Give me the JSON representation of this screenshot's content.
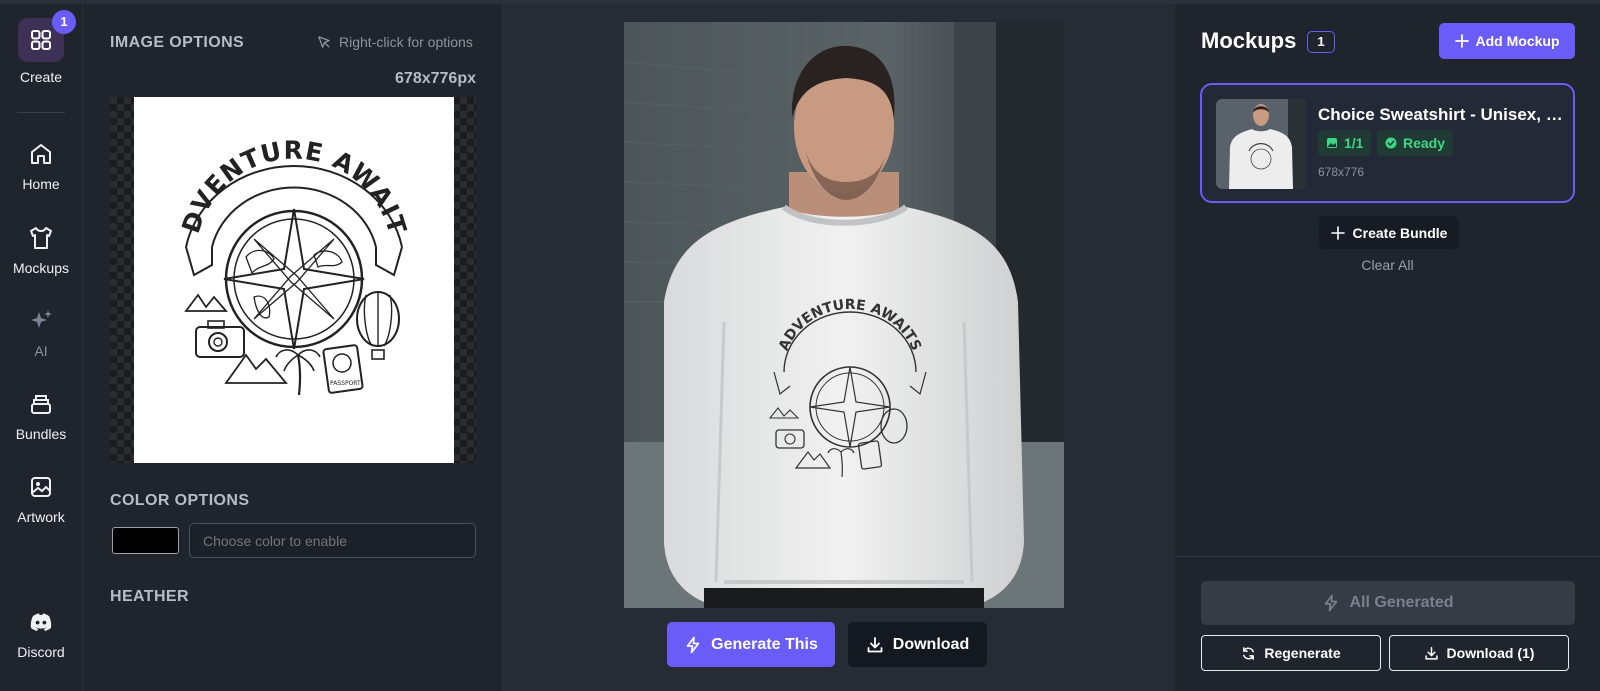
{
  "nav": {
    "create": {
      "label": "Create",
      "badge": "1"
    },
    "items": [
      {
        "label": "Home",
        "icon": "home-icon"
      },
      {
        "label": "Mockups",
        "icon": "tshirt-icon"
      },
      {
        "label": "AI",
        "icon": "sparkles-icon"
      },
      {
        "label": "Bundles",
        "icon": "stack-icon"
      },
      {
        "label": "Artwork",
        "icon": "image-icon"
      }
    ],
    "discord": {
      "label": "Discord",
      "icon": "discord-icon"
    }
  },
  "image_options": {
    "title": "IMAGE OPTIONS",
    "hint": "Right-click for options",
    "dimensions": "678x776px",
    "artwork_text": "ADVENTURE AWAITS",
    "passport_text": "PASSPORT"
  },
  "color_options": {
    "title": "COLOR OPTIONS",
    "swatch_color": "#000000",
    "placeholder": "Choose color to enable"
  },
  "heather": {
    "title": "HEATHER"
  },
  "preview": {
    "artwork_text": "ADVENTURE AWAITS",
    "generate_label": "Generate This",
    "download_label": "Download"
  },
  "mockups": {
    "title": "Mockups",
    "count": "1",
    "add_label": "Add Mockup",
    "card": {
      "name": "Choice Sweatshirt - Unisex, Gi...",
      "progress": "1/1",
      "status": "Ready",
      "dims": "678x776"
    },
    "create_bundle_label": "Create Bundle",
    "clear_all_label": "Clear All",
    "all_generated_label": "All Generated",
    "regenerate_label": "Regenerate",
    "download_all_label": "Download (1)"
  },
  "colors": {
    "accent": "#6a5cf7",
    "ready_green": "#3fd686",
    "background": "#1d222c"
  }
}
